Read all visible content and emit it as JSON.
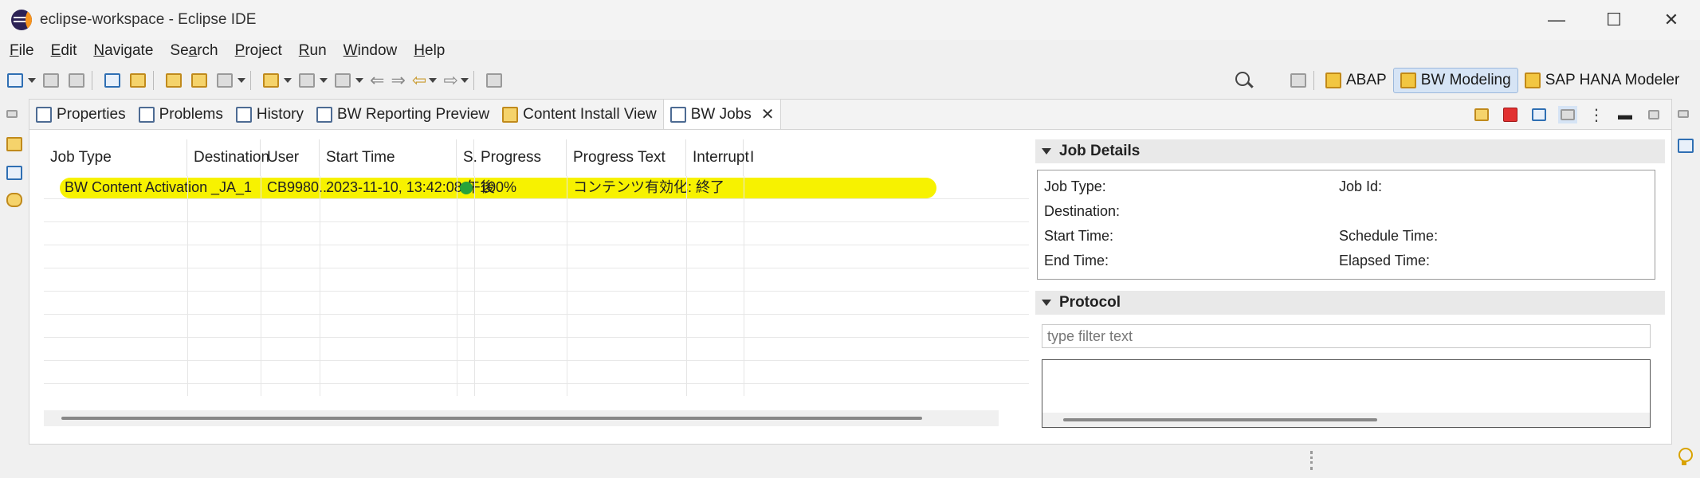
{
  "window": {
    "title": "eclipse-workspace - Eclipse IDE",
    "controls": [
      "—",
      "☐",
      "✕"
    ]
  },
  "menu": {
    "items": [
      {
        "label": "File",
        "u": "F",
        "rest": "ile"
      },
      {
        "label": "Edit",
        "u": "E",
        "rest": "dit"
      },
      {
        "label": "Navigate",
        "u": "N",
        "rest": "avigate"
      },
      {
        "label": "Search",
        "u": "a",
        "pre": "Se",
        "rest": "rch"
      },
      {
        "label": "Project",
        "u": "P",
        "rest": "roject"
      },
      {
        "label": "Run",
        "u": "R",
        "rest": "un"
      },
      {
        "label": "Window",
        "u": "W",
        "rest": "indow"
      },
      {
        "label": "Help",
        "u": "H",
        "rest": "elp"
      }
    ]
  },
  "perspectives": {
    "items": [
      "ABAP",
      "BW Modeling",
      "SAP HANA Modeler"
    ],
    "active": "BW Modeling"
  },
  "tabs": {
    "items": [
      "Properties",
      "Problems",
      "History",
      "BW Reporting Preview",
      "Content Install View",
      "BW Jobs"
    ],
    "active": "BW Jobs"
  },
  "table": {
    "columns": [
      "Job Type",
      "Destination",
      "User",
      "Start Time",
      "S.",
      "Progress",
      "Progress Text",
      "Interrupt",
      "I"
    ],
    "rows": [
      {
        "job_type": "BW Content Activation",
        "destination": "_JA_1",
        "user": "CB9980...",
        "start_time": "2023-11-10, 13:42:08 午後",
        "status": "green",
        "progress": "100%",
        "progress_text": "コンテンツ有効化: 終了",
        "interrupt": ""
      }
    ],
    "highlight_color": "#f7f200"
  },
  "job_details": {
    "header": "Job Details",
    "fields": {
      "job_type": "Job Type:",
      "job_id": "Job Id:",
      "destination": "Destination:",
      "start_time": "Start Time:",
      "schedule_time": "Schedule Time:",
      "end_time": "End Time:",
      "elapsed_time": "Elapsed Time:"
    }
  },
  "protocol": {
    "header": "Protocol",
    "filter_placeholder": "type filter text"
  },
  "colors": {
    "stop": "#e23131",
    "status_ok": "#27a33a",
    "active_perspective": "#d6e4f5"
  }
}
